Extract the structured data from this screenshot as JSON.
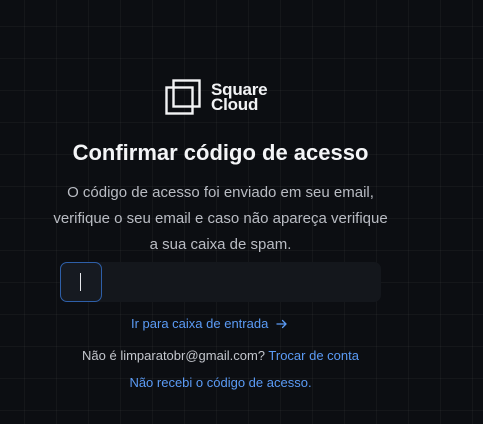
{
  "brand": {
    "line1": "Square",
    "line2": "Cloud"
  },
  "title": "Confirmar código de acesso",
  "subtitle": [
    "O código de acesso foi enviado em seu email,",
    "verifique o seu email e caso não apareça verifique",
    "a sua caixa de spam."
  ],
  "code_input": {
    "value": ""
  },
  "links": {
    "inbox": "Ir para caixa de entrada",
    "inbox_icon": "arrow-right-icon",
    "change_account": "Trocar de conta",
    "resend": "Não recebi o código de acesso."
  },
  "account_prompt": "Não é limparatobr@gmail.com?",
  "colors": {
    "background": "#0c0e12",
    "link": "#5b9bf5",
    "focus_border": "#2e5fa8"
  }
}
